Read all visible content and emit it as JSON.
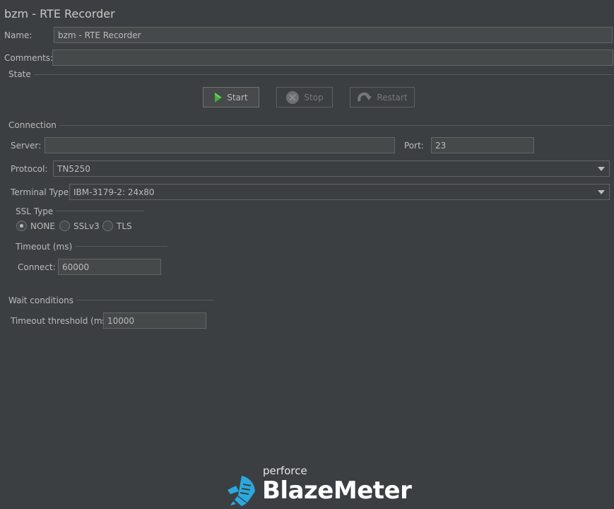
{
  "window": {
    "title": "bzm - RTE Recorder"
  },
  "name_row": {
    "label": "Name:",
    "value": "bzm - RTE Recorder"
  },
  "comments_row": {
    "label": "Comments:",
    "value": ""
  },
  "state": {
    "group_label": "State",
    "start_label": "Start",
    "stop_label": "Stop",
    "restart_label": "Restart"
  },
  "connection": {
    "group_label": "Connection",
    "server_label": "Server:",
    "server_value": "",
    "port_label": "Port:",
    "port_value": "23",
    "protocol_label": "Protocol:",
    "protocol_value": "TN5250",
    "terminal_type_label": "Terminal Type:",
    "terminal_type_value": "IBM-3179-2: 24x80"
  },
  "ssl": {
    "group_label": "SSL Type",
    "options": [
      "NONE",
      "SSLv3",
      "TLS"
    ],
    "selected": "NONE"
  },
  "timeout": {
    "group_label": "Timeout (ms)",
    "connect_label": "Connect:",
    "connect_value": "60000"
  },
  "wait": {
    "group_label": "Wait conditions",
    "threshold_label": "Timeout threshold (ms)",
    "threshold_value": "10000"
  },
  "brand": {
    "top": "perforce",
    "main": "BlazeMeter",
    "accent_color": "#2aa9e0"
  },
  "colors": {
    "background": "#3c3f41",
    "start_icon": "#3fae3a"
  }
}
